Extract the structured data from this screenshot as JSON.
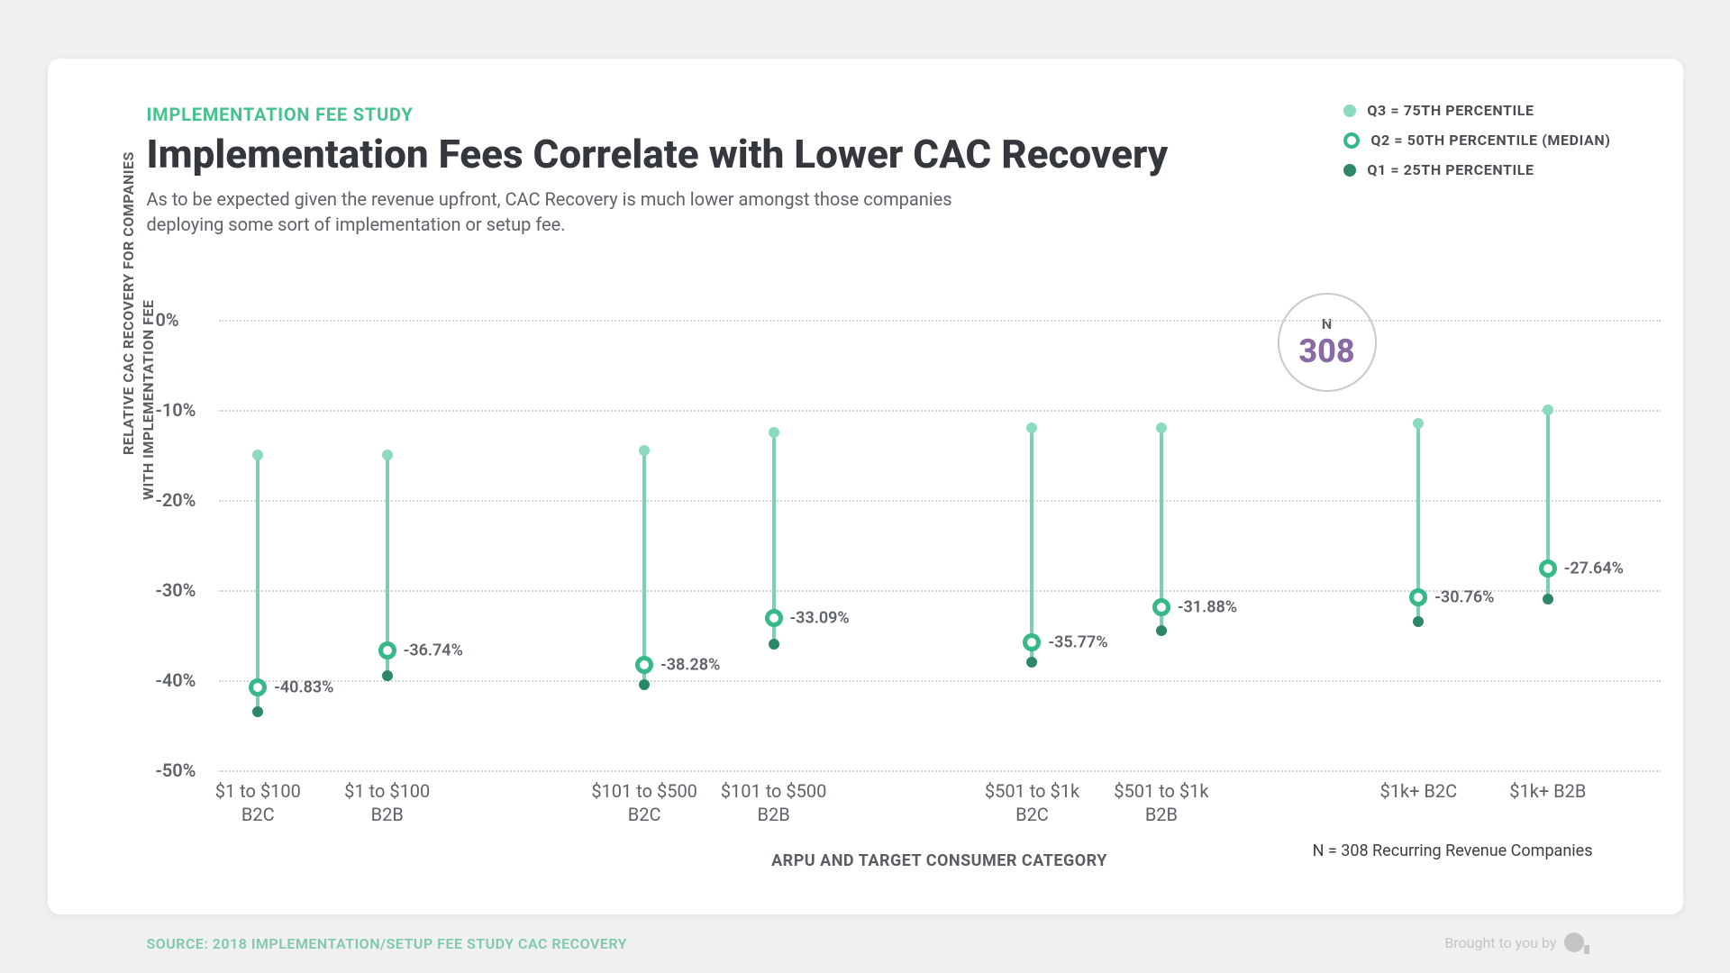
{
  "header": {
    "eyebrow": "IMPLEMENTATION FEE STUDY",
    "title": "Implementation Fees Correlate with Lower CAC Recovery",
    "subtitle": "As to be expected given the revenue upfront, CAC Recovery is much lower amongst those companies deploying some sort of implementation or setup fee."
  },
  "legend": {
    "q3": "Q3 = 75TH PERCENTILE",
    "q2": "Q2 = 50TH PERCENTILE (MEDIAN)",
    "q1": "Q1 = 25TH PERCENTILE"
  },
  "n_badge": {
    "label": "N",
    "value": "308"
  },
  "axes": {
    "y_label_line1": "RELATIVE CAC RECOVERY FOR COMPANIES",
    "y_label_line2": "WITH IMPLEMENTATION FEE",
    "x_label": "ARPU AND TARGET CONSUMER CATEGORY",
    "y_ticks": [
      "0%",
      "-10%",
      "-20%",
      "-30%",
      "-40%",
      "-50%"
    ]
  },
  "footer": {
    "n_note": "N = 308 Recurring Revenue Companies",
    "source": "SOURCE: 2018 IMPLEMENTATION/SETUP FEE STUDY CAC RECOVERY",
    "brought": "Brought to you by"
  },
  "chart_data": {
    "type": "range-dot",
    "ylabel": "Relative CAC Recovery for Companies with Implementation Fee",
    "xlabel": "ARPU and Target Consumer Category",
    "ylim": [
      -50,
      0
    ],
    "title": "Implementation Fees Correlate with Lower CAC Recovery",
    "categories": [
      {
        "line1": "$1 to $100",
        "line2": "B2C"
      },
      {
        "line1": "$1 to $100",
        "line2": "B2B"
      },
      {
        "line1": "$101 to $500",
        "line2": "B2C"
      },
      {
        "line1": "$101 to $500",
        "line2": "B2B"
      },
      {
        "line1": "$501 to $1k",
        "line2": "B2C"
      },
      {
        "line1": "$501 to $1k",
        "line2": "B2B"
      },
      {
        "line1": "$1k+ B2C",
        "line2": ""
      },
      {
        "line1": "$1k+ B2B",
        "line2": ""
      }
    ],
    "x_positions_pct": [
      2.9,
      12.4,
      31.3,
      40.8,
      59.8,
      69.3,
      88.2,
      97.7
    ],
    "series": [
      {
        "q3": -15.0,
        "q2": -40.83,
        "q1": -43.5,
        "median_label": "-40.83%"
      },
      {
        "q3": -15.0,
        "q2": -36.74,
        "q1": -39.5,
        "median_label": "-36.74%"
      },
      {
        "q3": -14.5,
        "q2": -38.28,
        "q1": -40.5,
        "median_label": "-38.28%"
      },
      {
        "q3": -12.5,
        "q2": -33.09,
        "q1": -36.0,
        "median_label": "-33.09%"
      },
      {
        "q3": -12.0,
        "q2": -35.77,
        "q1": -38.0,
        "median_label": "-35.77%"
      },
      {
        "q3": -12.0,
        "q2": -31.88,
        "q1": -34.5,
        "median_label": "-31.88%"
      },
      {
        "q3": -11.5,
        "q2": -30.76,
        "q1": -33.5,
        "median_label": "-30.76%"
      },
      {
        "q3": -10.0,
        "q2": -27.64,
        "q1": -31.0,
        "median_label": "-27.64%"
      }
    ]
  }
}
